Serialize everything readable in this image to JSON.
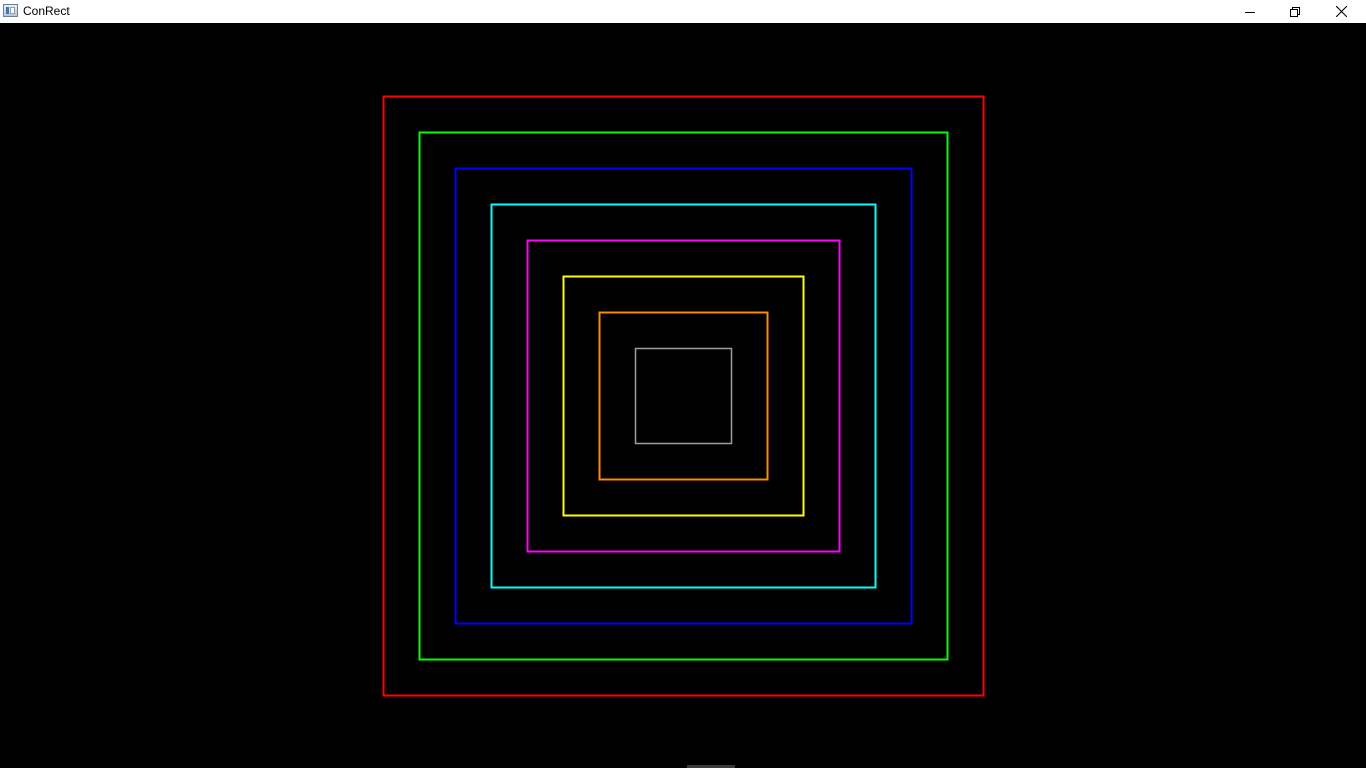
{
  "window": {
    "title": "ConRect"
  },
  "icons": {
    "app": "app-window-icon",
    "minimize": "minimize-icon",
    "restore": "restore-icon",
    "close": "close-icon"
  },
  "colors": {
    "background": "#000000",
    "titlebar": "#ffffff"
  },
  "rectangles": [
    {
      "name": "rect-red",
      "color": "#ff0000"
    },
    {
      "name": "rect-green",
      "color": "#00ff00"
    },
    {
      "name": "rect-blue",
      "color": "#0000ff"
    },
    {
      "name": "rect-cyan",
      "color": "#00ffff"
    },
    {
      "name": "rect-magenta",
      "color": "#ff00ff"
    },
    {
      "name": "rect-yellow",
      "color": "#ffff00"
    },
    {
      "name": "rect-orange",
      "color": "#ff8c00"
    },
    {
      "name": "rect-gray",
      "color": "#a0a0a0"
    }
  ]
}
